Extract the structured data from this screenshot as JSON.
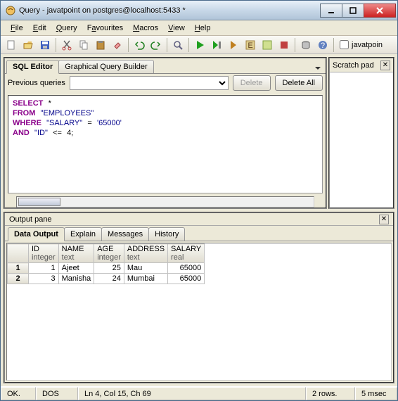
{
  "window": {
    "title": "Query - javatpoint on postgres@localhost:5433 *"
  },
  "menu": {
    "file_rest": "ile",
    "edit_rest": "dit",
    "query_rest": "uery",
    "fav_rest": "vourites",
    "macros_rest": "acros",
    "view_rest": "iew",
    "help_rest": "elp"
  },
  "toolbar": {
    "tab_label": "javatpoin"
  },
  "editor": {
    "tabs": [
      "SQL Editor",
      "Graphical Query Builder"
    ],
    "prev_label": "Previous queries",
    "delete_btn": "Delete",
    "delete_all_btn": "Delete All"
  },
  "sql": {
    "k1": "SELECT",
    "star": "*",
    "k2": "FROM",
    "tbl": "\"EMPLOYEES\"",
    "k3": "WHERE",
    "col1": "\"SALARY\"",
    "eq": "=",
    "val1": "'65000'",
    "k4": "AND",
    "col2": "\"ID\"",
    "lte": "<=",
    "val2": "4",
    "semi": ";"
  },
  "scratch": {
    "title": "Scratch pad"
  },
  "output": {
    "title": "Output pane",
    "tabs": [
      "Data Output",
      "Explain",
      "Messages",
      "History"
    ]
  },
  "grid": {
    "cols": [
      {
        "name": "ID",
        "type": "integer"
      },
      {
        "name": "NAME",
        "type": "text"
      },
      {
        "name": "AGE",
        "type": "integer"
      },
      {
        "name": "ADDRESS",
        "type": "text"
      },
      {
        "name": "SALARY",
        "type": "real"
      }
    ],
    "rows": [
      {
        "n": "1",
        "id": "1",
        "name": "Ajeet",
        "age": "25",
        "address": "Mau",
        "salary": "65000"
      },
      {
        "n": "2",
        "id": "3",
        "name": "Manisha",
        "age": "24",
        "address": "Mumbai",
        "salary": "65000"
      }
    ]
  },
  "status": {
    "ok": "OK.",
    "mode": "DOS",
    "cursor": "Ln 4, Col 15, Ch 69",
    "rows": "2 rows.",
    "time": "5 msec"
  }
}
